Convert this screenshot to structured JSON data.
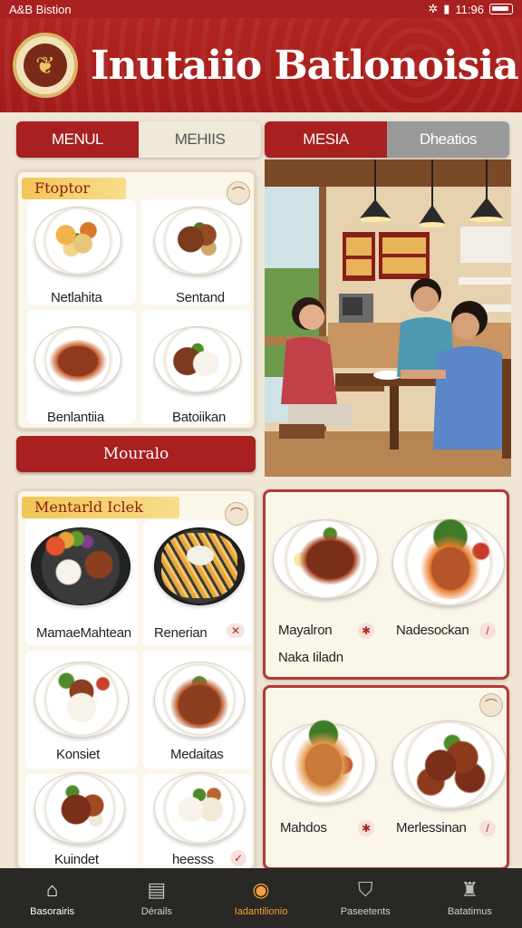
{
  "status_bar": {
    "left": "A&B  Bistion",
    "right": "11:96"
  },
  "header": {
    "title": "Inutaiio Batlonoisia",
    "menu_icon": "dots-vertical-icon",
    "logo_icon": "restaurant-logo-icon"
  },
  "tabs_left": [
    {
      "label": "MENUL"
    },
    {
      "label": "MEHIIS"
    }
  ],
  "tabs_right": [
    {
      "label": "MESIA"
    },
    {
      "label": "Dheatios"
    }
  ],
  "card1": {
    "tag": "Ftoptor",
    "items": [
      {
        "label": "Netlahita"
      },
      {
        "label": "Sentand"
      },
      {
        "label": "Benlantiia"
      },
      {
        "label": "Batoiikan"
      }
    ],
    "button": "Mouralo"
  },
  "card2": {
    "tag": "Mentarld Iclek",
    "items": [
      {
        "label": "MamaeMahtean"
      },
      {
        "label": "Renerian"
      },
      {
        "label": "Konsiet"
      },
      {
        "label": "Medaitas"
      },
      {
        "label": "Kuindet"
      },
      {
        "label": "heesss"
      }
    ]
  },
  "card3": {
    "items": [
      {
        "label": "Mayalron"
      },
      {
        "label": "Nadesockan"
      }
    ],
    "sub_label": "Naka Iiladn"
  },
  "card4": {
    "items": [
      {
        "label": "Mahdos"
      },
      {
        "label": "Merlessinan"
      }
    ]
  },
  "bottom_nav": [
    {
      "label": "Basorairis",
      "icon": "home-icon"
    },
    {
      "label": "Dérails",
      "icon": "document-icon"
    },
    {
      "label": "Iadantilionio",
      "icon": "info-circle-icon"
    },
    {
      "label": "Paseetents",
      "icon": "shield-icon"
    },
    {
      "label": "Batatimus",
      "icon": "chef-icon"
    }
  ],
  "colors": {
    "brand_red": "#a8201f",
    "gold": "#f2c657",
    "nav_active": "#f2a33a"
  }
}
